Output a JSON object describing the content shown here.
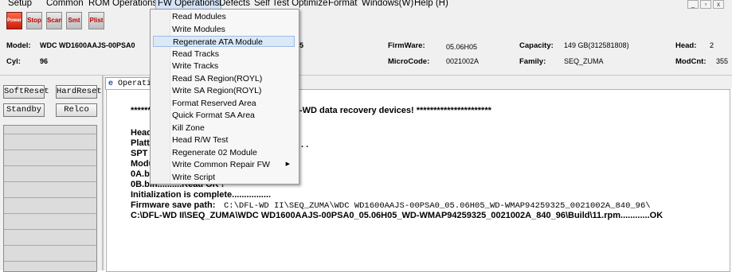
{
  "menubar": {
    "items": [
      {
        "id": "setup",
        "label": "Setup"
      },
      {
        "id": "common",
        "label": "Common"
      },
      {
        "id": "rom",
        "label": "ROM Operations"
      },
      {
        "id": "fw",
        "label": "FW Operations"
      },
      {
        "id": "defects",
        "label": "Defects"
      },
      {
        "id": "selftest",
        "label": "Self Test Optimize"
      },
      {
        "id": "format",
        "label": "Format"
      },
      {
        "id": "windows",
        "label": "Windows(W)"
      },
      {
        "id": "help",
        "label": "Help (H)"
      }
    ],
    "window_controls": {
      "minimize": "_",
      "restore": "▫",
      "close": "x"
    }
  },
  "toolbar": {
    "power": "Power",
    "stop": "Stop",
    "scan": "Scan",
    "smt": "Smt",
    "plist": "Plist"
  },
  "info": {
    "model_label": "Model:",
    "model_value": "WDC WD1600AAJS-00PSA0",
    "model_suffix": "5",
    "cyl_label": "Cyl:",
    "cyl_value": "96",
    "firmware_label": "FirmWare:",
    "firmware_value": "05.06H05",
    "microcode_label": "MicroCode:",
    "microcode_value": "0021002A",
    "capacity_label": "Capacity:",
    "capacity_value": "149 GB(312581808)",
    "family_label": "Family:",
    "family_value": "SEQ_ZUMA",
    "head_label": "Head:",
    "head_value": "2",
    "modcnt_label": "ModCnt:",
    "modcnt_value": "355"
  },
  "left_panel": {
    "softreset": "SoftReset",
    "hardreset": "HardReset",
    "standby": "Standby",
    "relco": "Relco"
  },
  "tabs": {
    "operation": "Operation"
  },
  "output": {
    "banner_left": "******",
    "banner_right": "-WD data recovery devices! **********************",
    "line_head": "Head",
    "line_platter": "Platte",
    "line_platter_dots": ". .",
    "line_spt": "SPT",
    "line_modu": "Modu",
    "line_0a": "0A.bin",
    "line_0b": "0B.bin..........Read OK !",
    "line_init": "Initialization is complete................",
    "line_save_label": "Firmware save path:",
    "line_save_path": "C:\\DFL-WD II\\SEQ_ZUMA\\WDC WD1600AAJS-00PSA0_05.06H05_WD-WMAP94259325_0021002A_840_96\\",
    "line_rpm": "C:\\DFL-WD II\\SEQ_ZUMA\\WDC WD1600AAJS-00PSA0_05.06H05_WD-WMAP94259325_0021002A_840_96\\Build\\11.rpm............OK"
  },
  "fw_menu": {
    "items": [
      {
        "label": "Read Modules",
        "highlighted": false,
        "submenu": false
      },
      {
        "label": "Write Modules",
        "highlighted": false,
        "submenu": false
      },
      {
        "label": "Regenerate ATA Module",
        "highlighted": true,
        "submenu": false
      },
      {
        "label": "Read Tracks",
        "highlighted": false,
        "submenu": false
      },
      {
        "label": "Write Tracks",
        "highlighted": false,
        "submenu": false
      },
      {
        "label": "Read SA Region(ROYL)",
        "highlighted": false,
        "submenu": false
      },
      {
        "label": "Write SA Region(ROYL)",
        "highlighted": false,
        "submenu": false
      },
      {
        "label": "Format Reserved Area",
        "highlighted": false,
        "submenu": false
      },
      {
        "label": "Quick Format SA Area",
        "highlighted": false,
        "submenu": false
      },
      {
        "label": "Kill Zone",
        "highlighted": false,
        "submenu": false
      },
      {
        "label": "Head R/W Test",
        "highlighted": false,
        "submenu": false
      },
      {
        "label": "Regenerate 02 Module",
        "highlighted": false,
        "submenu": false
      },
      {
        "label": "Write Common Repair FW",
        "highlighted": false,
        "submenu": true
      },
      {
        "label": "Write Script",
        "highlighted": false,
        "submenu": false
      }
    ],
    "submenu_arrow": "▶"
  },
  "colors": {
    "menu_highlight": "#dbe8f8",
    "power_button": "#c81e0a",
    "toolbar_text": "#c00000"
  }
}
